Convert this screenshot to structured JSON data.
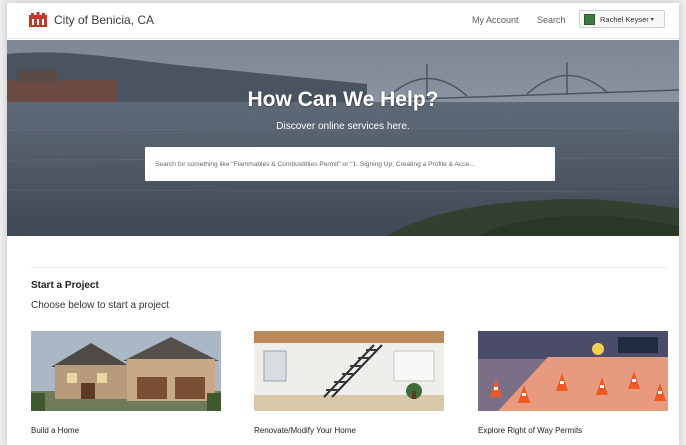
{
  "header": {
    "logo_text": "City of Benicia, CA",
    "nav": {
      "my_account": "My Account",
      "search": "Search"
    },
    "user": {
      "name": "Rachel Keyser",
      "caret": "▾"
    }
  },
  "hero": {
    "title": "How Can We Help?",
    "subtitle": "Discover online services here.",
    "search_placeholder": "Search for something like \"Flammables & Combustibles Permit\" or \"1. Signing Up, Creating a Profile & Acce..."
  },
  "section": {
    "title": "Start a Project",
    "subtitle": "Choose below to start a project"
  },
  "cards": [
    {
      "label": "Build a Home"
    },
    {
      "label": "Renovate/Modify Your Home"
    },
    {
      "label": "Explore Right of Way Permits"
    }
  ],
  "colors": {
    "accent": "#c0392b",
    "hero_overlay": "#55606e"
  }
}
